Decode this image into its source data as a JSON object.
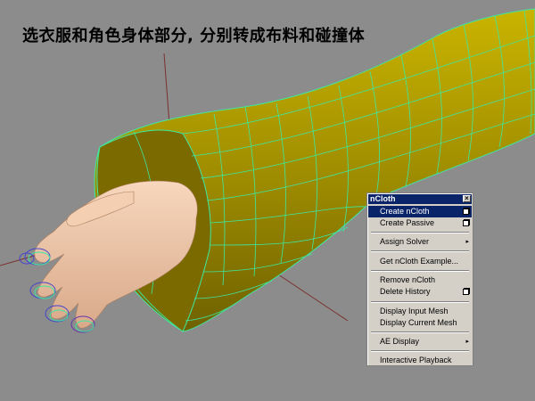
{
  "caption": "选衣服和角色身体部分, 分别转成布料和碰撞体",
  "menu": {
    "title": "nCloth",
    "items": [
      {
        "label": "Create nCloth",
        "highlighted": true,
        "icon": "option-box-icon"
      },
      {
        "label": "Create Passive",
        "icon": "option-box-icon"
      },
      {
        "label": "Assign Solver",
        "icon": "submenu-arrow-icon"
      },
      {
        "label": "Get nCloth Example..."
      },
      {
        "label": "Remove nCloth"
      },
      {
        "label": "Delete History",
        "icon": "option-box-icon"
      },
      {
        "label": "Display Input Mesh"
      },
      {
        "label": "Display Current Mesh"
      },
      {
        "label": "AE Display",
        "icon": "submenu-arrow-icon"
      },
      {
        "label": "Interactive Playback"
      }
    ]
  },
  "colors": {
    "viewport_bg": "#8c8c8c",
    "sleeve": "#b2a000",
    "wireframe": "#3ee8a0",
    "skin": "#f2c9a8",
    "highlight": "#0a246a"
  }
}
